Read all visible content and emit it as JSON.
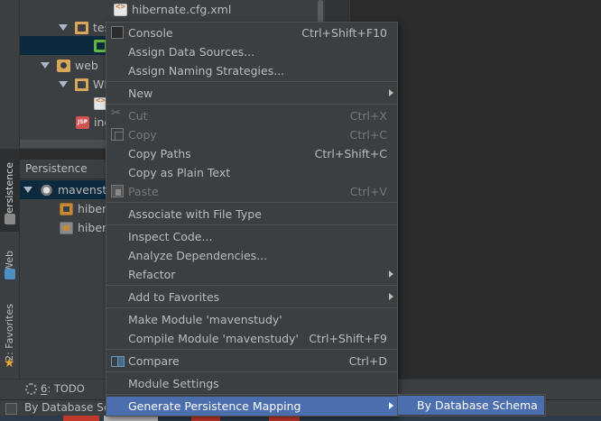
{
  "project_tree": {
    "rows": [
      {
        "label": "hibernate.cfg.xml"
      },
      {
        "label": "tes"
      },
      {
        "label": ""
      },
      {
        "label": "web"
      },
      {
        "label": "WE"
      },
      {
        "label": ""
      },
      {
        "label": "ind"
      }
    ]
  },
  "left_stripe": {
    "persistence_tab": "Persistence",
    "web_tab": "Web",
    "favorites_tab": "2: Favorites"
  },
  "persistence_panel": {
    "title": "Persistence",
    "rows": [
      {
        "label": "mavenstu"
      },
      {
        "label": "hibern"
      },
      {
        "label": "hibern"
      }
    ]
  },
  "bottom_toolbar": {
    "todo_number": "6",
    "todo_label": ": TODO"
  },
  "status_bar": {
    "text": "By Database Sc"
  },
  "context_menu": {
    "items": {
      "console": {
        "label": "Console",
        "shortcut": "Ctrl+Shift+F10"
      },
      "assign_data_sources": {
        "label": "Assign Data Sources..."
      },
      "assign_naming_strategies": {
        "label": "Assign Naming Strategies..."
      },
      "new": {
        "label": "New"
      },
      "cut": {
        "label": "Cut",
        "shortcut": "Ctrl+X"
      },
      "copy": {
        "label": "Copy",
        "shortcut": "Ctrl+C"
      },
      "copy_paths": {
        "label": "Copy Paths",
        "shortcut": "Ctrl+Shift+C"
      },
      "copy_as_plain_text": {
        "label": "Copy as Plain Text"
      },
      "paste": {
        "label": "Paste",
        "shortcut": "Ctrl+V"
      },
      "associate_file_type": {
        "label": "Associate with File Type"
      },
      "inspect_code": {
        "label": "Inspect Code..."
      },
      "analyze_dependencies": {
        "label": "Analyze Dependencies..."
      },
      "refactor": {
        "label": "Refactor"
      },
      "add_to_favorites": {
        "label": "Add to Favorites"
      },
      "make_module": {
        "label": "Make Module 'mavenstudy'"
      },
      "compile_module": {
        "label": "Compile Module 'mavenstudy'",
        "shortcut": "Ctrl+Shift+F9"
      },
      "compare": {
        "label": "Compare",
        "shortcut": "Ctrl+D"
      },
      "module_settings": {
        "label": "Module Settings"
      },
      "generate_persistence_mapping": {
        "label": "Generate Persistence Mapping"
      }
    }
  },
  "submenu": {
    "by_database_schema": "By Database Schema"
  },
  "colors": {
    "background": "#3c3f41",
    "editor": "#2b2b2b",
    "selection": "#4b6eaf",
    "tree_selection": "#0d293e",
    "separator": "#515151",
    "text": "#bbbbbb",
    "disabled_text": "#777777"
  }
}
